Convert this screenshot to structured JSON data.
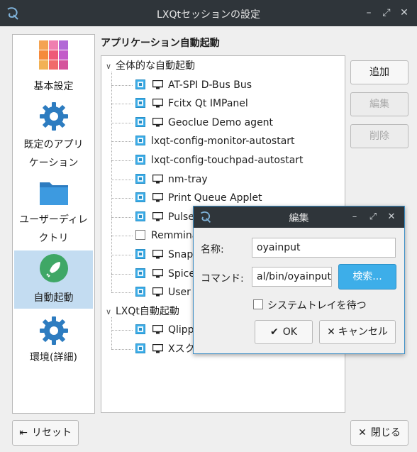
{
  "window": {
    "title": "LXQtセッションの設定",
    "controls": {
      "minimize": "–",
      "maximize": "⤢",
      "close": "✕"
    }
  },
  "sidebar": {
    "items": [
      {
        "label": "基本設定",
        "icon": "color-grid-icon"
      },
      {
        "label": "既定のアプリ\nケーション",
        "icon": "gear-icon"
      },
      {
        "label": "ユーザーディレ\nクトリ",
        "icon": "folder-icon"
      },
      {
        "label": "自動起動",
        "icon": "rocket-icon",
        "selected": true
      },
      {
        "label": "環境(詳細)",
        "icon": "gear-icon"
      }
    ]
  },
  "main": {
    "section_title": "アプリケーション自動起動",
    "groups": [
      {
        "label": "全体的な自動起動",
        "items": [
          {
            "label": "AT-SPI D-Bus Bus",
            "checked": true,
            "icon": true
          },
          {
            "label": "Fcitx Qt IMPanel",
            "checked": true,
            "icon": true
          },
          {
            "label": "Geoclue Demo agent",
            "checked": true,
            "icon": true
          },
          {
            "label": "lxqt-config-monitor-autostart",
            "checked": true,
            "icon": false
          },
          {
            "label": "lxqt-config-touchpad-autostart",
            "checked": true,
            "icon": false
          },
          {
            "label": "nm-tray",
            "checked": true,
            "icon": true
          },
          {
            "label": "Print Queue Applet",
            "checked": true,
            "icon": true
          },
          {
            "label": "Pulse",
            "checked": true,
            "icon": true
          },
          {
            "label": "Remmina",
            "checked": false,
            "icon": false
          },
          {
            "label": "Snap u",
            "checked": true,
            "icon": true
          },
          {
            "label": "Spice",
            "checked": true,
            "icon": true
          },
          {
            "label": "User f",
            "checked": true,
            "icon": true
          }
        ]
      },
      {
        "label": "LXQt自動起動",
        "items": [
          {
            "label": "Qlipp",
            "checked": true,
            "icon": true
          },
          {
            "label": "Xスクリーンセーバ",
            "checked": true,
            "icon": true
          }
        ]
      }
    ],
    "buttons": {
      "add": "追加",
      "edit": "編集",
      "delete": "削除"
    }
  },
  "footer": {
    "reset": "リセット",
    "close": "閉じる"
  },
  "dialog": {
    "title": "編集",
    "name_label": "名称:",
    "name_value": "oyainput",
    "command_label": "コマンド:",
    "command_value": "al/bin/oyainput",
    "browse": "検索...",
    "tray_label": "システムトレイを待つ",
    "tray_checked": false,
    "ok": "OK",
    "cancel": "キャンセル",
    "controls": {
      "minimize": "–",
      "maximize": "⤢",
      "close": "✕"
    }
  }
}
